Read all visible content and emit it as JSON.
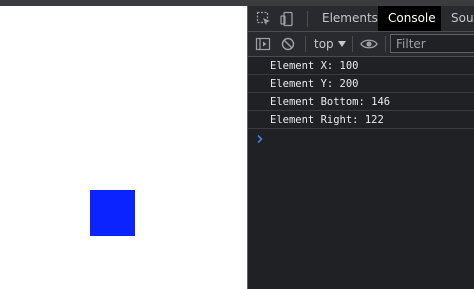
{
  "page": {
    "box_color": "#0a23ff"
  },
  "devtools": {
    "tabs": [
      {
        "label": "Elements",
        "active": false
      },
      {
        "label": "Console",
        "active": true
      },
      {
        "label": "Sou",
        "active": false
      }
    ],
    "toolbar": {
      "context": "top",
      "filter_placeholder": "Filter"
    },
    "console_logs": [
      "Element X: 100",
      "Element Y: 200",
      "Element Bottom: 146",
      "Element Right: 122"
    ],
    "colors": {
      "accent_prompt": "#4285f4"
    }
  }
}
